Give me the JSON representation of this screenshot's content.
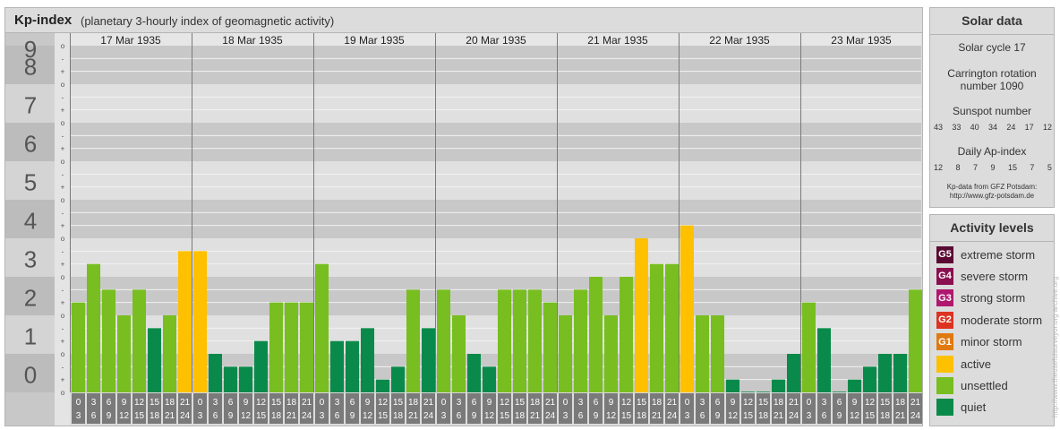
{
  "header": {
    "title": "Kp-index",
    "subtitle": "(planetary 3-hourly index of geomagnetic activity)"
  },
  "chart_data": {
    "type": "bar",
    "ylim": [
      0,
      9
    ],
    "y_ticks": [
      "0",
      "1",
      "2",
      "3",
      "4",
      "5",
      "6",
      "7",
      "8",
      "9"
    ],
    "minor_ticks": [
      "o",
      "+",
      "-",
      "o",
      "+",
      "-",
      "o",
      "+",
      "-",
      "o",
      "+",
      "-",
      "o",
      "+",
      "-",
      "o",
      "+",
      "-",
      "o",
      "+",
      "-",
      "o",
      "+",
      "-",
      "o",
      "+",
      "-",
      "o"
    ],
    "days": [
      "17 Mar 1935",
      "18 Mar 1935",
      "19 Mar 1935",
      "20 Mar 1935",
      "21 Mar 1935",
      "22 Mar 1935",
      "23 Mar 1935"
    ],
    "interval_starts": [
      "0",
      "3",
      "6",
      "9",
      "12",
      "15",
      "18",
      "21"
    ],
    "interval_ends": [
      "3",
      "6",
      "9",
      "12",
      "15",
      "18",
      "21",
      "24"
    ],
    "values": [
      [
        2.333,
        3.333,
        2.667,
        2.0,
        2.667,
        1.667,
        2.0,
        3.667
      ],
      [
        3.667,
        1.0,
        0.667,
        0.667,
        1.333,
        2.333,
        2.333,
        2.333
      ],
      [
        3.333,
        1.333,
        1.333,
        1.667,
        0.333,
        0.667,
        2.667,
        1.667
      ],
      [
        2.667,
        2.0,
        1.0,
        0.667,
        2.667,
        2.667,
        2.667,
        2.333
      ],
      [
        2.0,
        2.667,
        3.0,
        2.0,
        3.0,
        4.0,
        3.333,
        3.333
      ],
      [
        4.333,
        2.0,
        2.0,
        0.333,
        0.0,
        0.0,
        0.333,
        1.0
      ],
      [
        2.333,
        1.667,
        0.0,
        0.333,
        0.667,
        1.0,
        1.0,
        2.667
      ]
    ],
    "colors": {
      "quiet": "#0a8a4a",
      "unsettled": "#78be20",
      "active": "#ffc000"
    },
    "grid": true
  },
  "solar": {
    "title": "Solar data",
    "cycle": "Solar cycle 17",
    "carrington_line1": "Carrington rotation",
    "carrington_line2": "number 1090",
    "sunspot_label": "Sunspot number",
    "sunspot_values": [
      "43",
      "33",
      "40",
      "34",
      "24",
      "17",
      "12"
    ],
    "ap_label": "Daily Ap-index",
    "ap_values": [
      "12",
      "8",
      "7",
      "9",
      "15",
      "7",
      "5"
    ],
    "source_line1": "Kp-data from GFZ Potsdam:",
    "source_line2": "http://www.gfz-potsdam.de"
  },
  "levels": {
    "title": "Activity levels",
    "items": [
      {
        "code": "G5",
        "label": "extreme storm",
        "color": "#5a0a32"
      },
      {
        "code": "G4",
        "label": "severe storm",
        "color": "#8a1050"
      },
      {
        "code": "G3",
        "label": "strong storm",
        "color": "#b01870"
      },
      {
        "code": "G2",
        "label": "moderate storm",
        "color": "#dd3322"
      },
      {
        "code": "G1",
        "label": "minor storm",
        "color": "#e07a10"
      },
      {
        "code": "",
        "label": "active",
        "color": "#ffc000"
      },
      {
        "code": "",
        "label": "unsettled",
        "color": "#78be20"
      },
      {
        "code": "",
        "label": "quiet",
        "color": "#0a8a4a"
      }
    ]
  },
  "watermark": "http://www.theusefulsurveyor.org  archive.org"
}
